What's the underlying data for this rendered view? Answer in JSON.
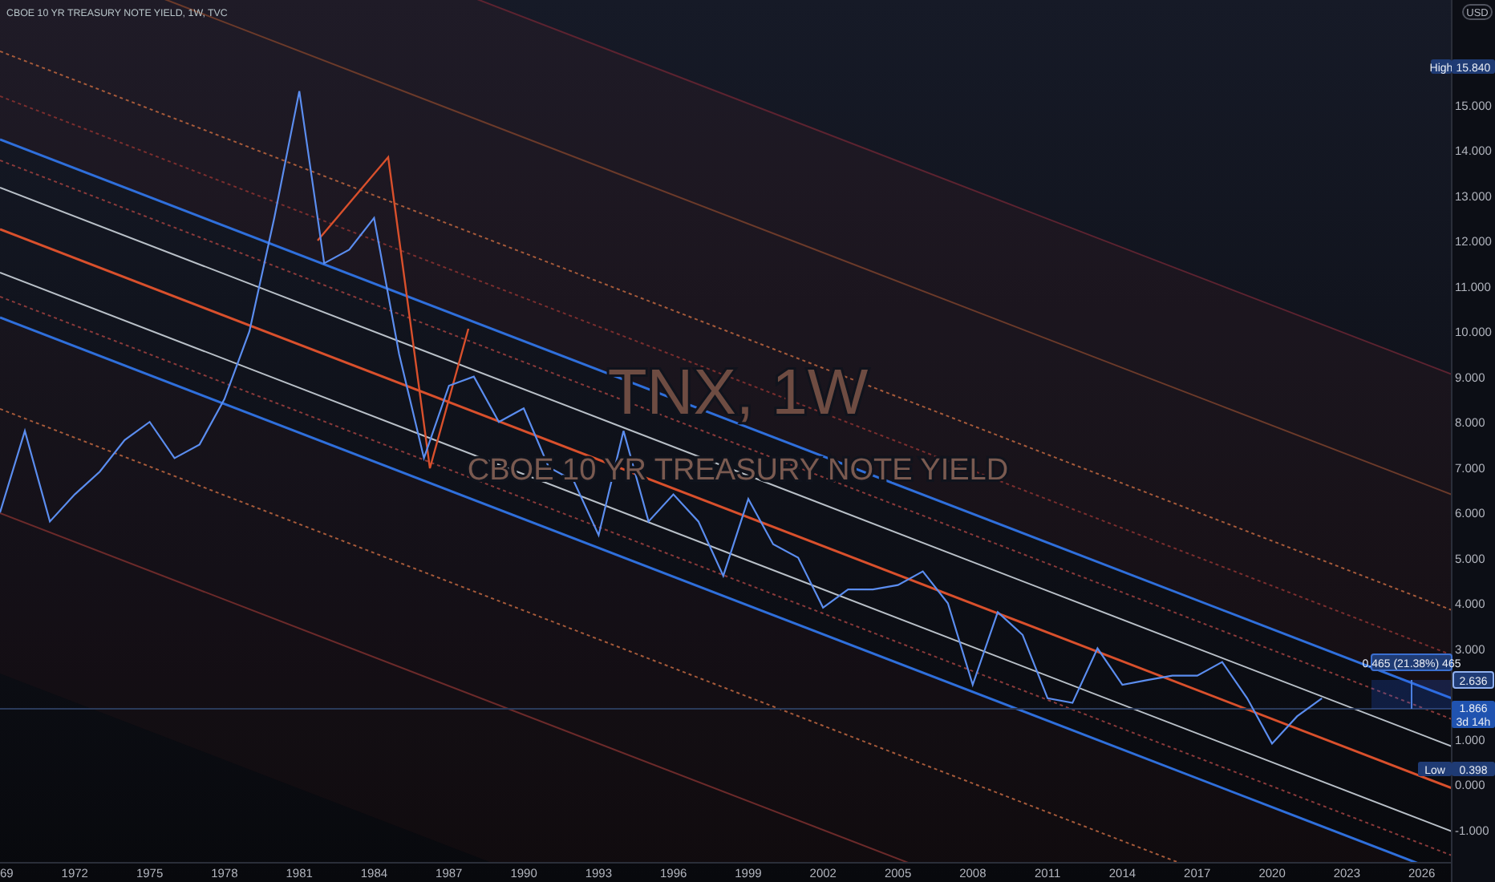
{
  "legend": "CBOE 10 YR TREASURY NOTE YIELD, 1W, TVC",
  "currency": "USD",
  "watermark": {
    "symbol": "TNX, 1W",
    "description": "CBOE 10 YR TREASURY NOTE YIELD"
  },
  "chart_data": {
    "type": "line",
    "x": [
      1969,
      1970,
      1971,
      1972,
      1973,
      1974,
      1975,
      1976,
      1977,
      1978,
      1979,
      1980,
      1981,
      1982,
      1983,
      1984,
      1985,
      1986,
      1987,
      1988,
      1989,
      1990,
      1991,
      1992,
      1993,
      1994,
      1995,
      1996,
      1997,
      1998,
      1999,
      2000,
      2001,
      2002,
      2003,
      2004,
      2005,
      2006,
      2007,
      2008,
      2009,
      2010,
      2011,
      2012,
      2013,
      2014,
      2015,
      2016,
      2017,
      2018,
      2019,
      2020,
      2021,
      2022
    ],
    "series": [
      {
        "color": "#5b8def",
        "values": [
          6.0,
          7.8,
          5.8,
          6.4,
          6.9,
          7.6,
          8.0,
          7.2,
          7.5,
          8.5,
          10.0,
          12.5,
          15.3,
          11.5,
          11.8,
          12.5,
          9.5,
          7.2,
          8.8,
          9.0,
          8.0,
          8.3,
          7.0,
          6.7,
          5.5,
          7.8,
          5.8,
          6.4,
          5.8,
          4.6,
          6.3,
          5.3,
          5.0,
          3.9,
          4.3,
          4.3,
          4.4,
          4.7,
          4.0,
          2.2,
          3.8,
          3.3,
          1.9,
          1.8,
          3.0,
          2.2,
          2.3,
          2.4,
          2.4,
          2.7,
          1.9,
          0.9,
          1.5,
          1.9
        ]
      }
    ],
    "xlim": [
      1969,
      2027.2
    ],
    "ylim": [
      -1.73,
      17.31
    ],
    "xticks": [
      {
        "value": 1972,
        "label": "1972"
      },
      {
        "value": 1975,
        "label": "1975"
      },
      {
        "value": 1978,
        "label": "1978"
      },
      {
        "value": 1981,
        "label": "1981"
      },
      {
        "value": 1984,
        "label": "1984"
      },
      {
        "value": 1987,
        "label": "1987"
      },
      {
        "value": 1990,
        "label": "1990"
      },
      {
        "value": 1993,
        "label": "1993"
      },
      {
        "value": 1996,
        "label": "1996"
      },
      {
        "value": 1999,
        "label": "1999"
      },
      {
        "value": 2002,
        "label": "2002"
      },
      {
        "value": 2005,
        "label": "2005"
      },
      {
        "value": 2008,
        "label": "2008"
      },
      {
        "value": 2011,
        "label": "2011"
      },
      {
        "value": 2014,
        "label": "2014"
      },
      {
        "value": 2017,
        "label": "2017"
      },
      {
        "value": 2020,
        "label": "2020"
      },
      {
        "value": 2023,
        "label": "2023"
      },
      {
        "value": 2026,
        "label": "2026"
      }
    ],
    "yticks": [
      {
        "value": 15,
        "label": "15.000"
      },
      {
        "value": 14,
        "label": "14.000"
      },
      {
        "value": 13,
        "label": "13.000"
      },
      {
        "value": 12,
        "label": "12.000"
      },
      {
        "value": 11,
        "label": "11.000"
      },
      {
        "value": 10,
        "label": "10.000"
      },
      {
        "value": 9,
        "label": "9.000"
      },
      {
        "value": 8,
        "label": "8.000"
      },
      {
        "value": 7,
        "label": "7.000"
      },
      {
        "value": 6,
        "label": "6.000"
      },
      {
        "value": 5,
        "label": "5.000"
      },
      {
        "value": 4,
        "label": "4.000"
      },
      {
        "value": 3,
        "label": "3.000"
      },
      {
        "value": 1,
        "label": "1.000"
      },
      {
        "value": 0,
        "label": "0.000"
      },
      {
        "value": -1,
        "label": "-1.000"
      }
    ]
  },
  "time_axis_cut_label": "69",
  "high": {
    "label": "High",
    "value": "15.840"
  },
  "low": {
    "label": "Low",
    "value": "0.398"
  },
  "measure": {
    "label": "0.465 (21.38%) 465",
    "value": "2.636"
  },
  "last_price": {
    "value": "1.866",
    "countdown": "3d 14h"
  }
}
